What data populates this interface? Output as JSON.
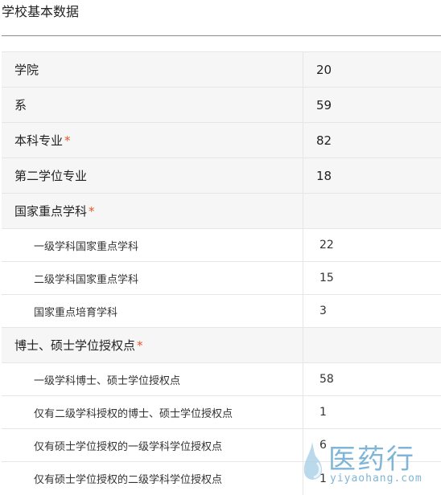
{
  "page": {
    "title": "学校基本数据"
  },
  "table": {
    "rows": [
      {
        "kind": "category",
        "label": "学院",
        "value": "20",
        "asterisk": false
      },
      {
        "kind": "category",
        "label": "系",
        "value": "59",
        "asterisk": false
      },
      {
        "kind": "category",
        "label": "本科专业",
        "value": "82",
        "asterisk": true
      },
      {
        "kind": "category",
        "label": "第二学位专业",
        "value": "18",
        "asterisk": false
      },
      {
        "kind": "category",
        "label": "国家重点学科",
        "value": "",
        "asterisk": true
      },
      {
        "kind": "sub",
        "label": "一级学科国家重点学科",
        "value": "22"
      },
      {
        "kind": "sub",
        "label": "二级学科国家重点学科",
        "value": "15"
      },
      {
        "kind": "sub",
        "label": "国家重点培育学科",
        "value": "3"
      },
      {
        "kind": "category",
        "label": "博士、硕士学位授权点",
        "value": "",
        "asterisk": true
      },
      {
        "kind": "sub",
        "label": "一级学科博士、硕士学位授权点",
        "value": "58"
      },
      {
        "kind": "sub",
        "label": "仅有二级学科授权的博士、硕士学位授权点",
        "value": "1"
      },
      {
        "kind": "sub",
        "label": "仅有硕士学位授权的一级学科学位授权点",
        "value": "6"
      },
      {
        "kind": "sub",
        "label": "仅有硕士学位授权的二级学科学位授权点",
        "value": "1"
      }
    ],
    "asterisk_mark": "*"
  },
  "watermark": {
    "text": "医药行",
    "subtext": "yiyaohang.com",
    "color": "#7fb5d6"
  },
  "colors": {
    "asterisk": "#e4572e",
    "category_bg": "#f6f6f6",
    "border": "#e6e6e6"
  }
}
